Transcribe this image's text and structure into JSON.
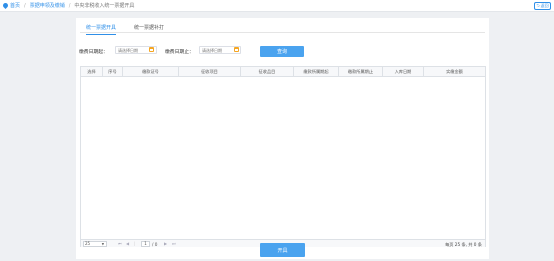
{
  "breadcrumb": {
    "home": "首页",
    "level2": "票据申领及缴销",
    "current": "中央非税收入统一票据开具"
  },
  "back_button": {
    "icon": "back-arrow-icon",
    "label": "返回"
  },
  "tabs": [
    {
      "label": "统一票据开具",
      "active": true
    },
    {
      "label": "统一票据补打",
      "active": false
    }
  ],
  "filters": {
    "start_label": "缴费日期起：",
    "start_placeholder": "请选择日期",
    "end_label": "缴费日期止：",
    "end_placeholder": "请选择日期",
    "calendar_icon": "calendar-icon",
    "query_button": "查询"
  },
  "table": {
    "columns": [
      "选择",
      "序号",
      "缴款证号",
      "征收项目",
      "征收品目",
      "缴款所属期起",
      "缴款所属期止",
      "入库日期",
      "实缴金额"
    ],
    "rows": []
  },
  "pager": {
    "page_size": "25",
    "current_page": "1",
    "total_pages": "/ 0",
    "summary": "每页 25 条, 共 0 条"
  },
  "submit_button": "开具",
  "colors": {
    "accent": "#2f8fe8",
    "button": "#4aa3ef",
    "calendar": "#f5a623"
  }
}
